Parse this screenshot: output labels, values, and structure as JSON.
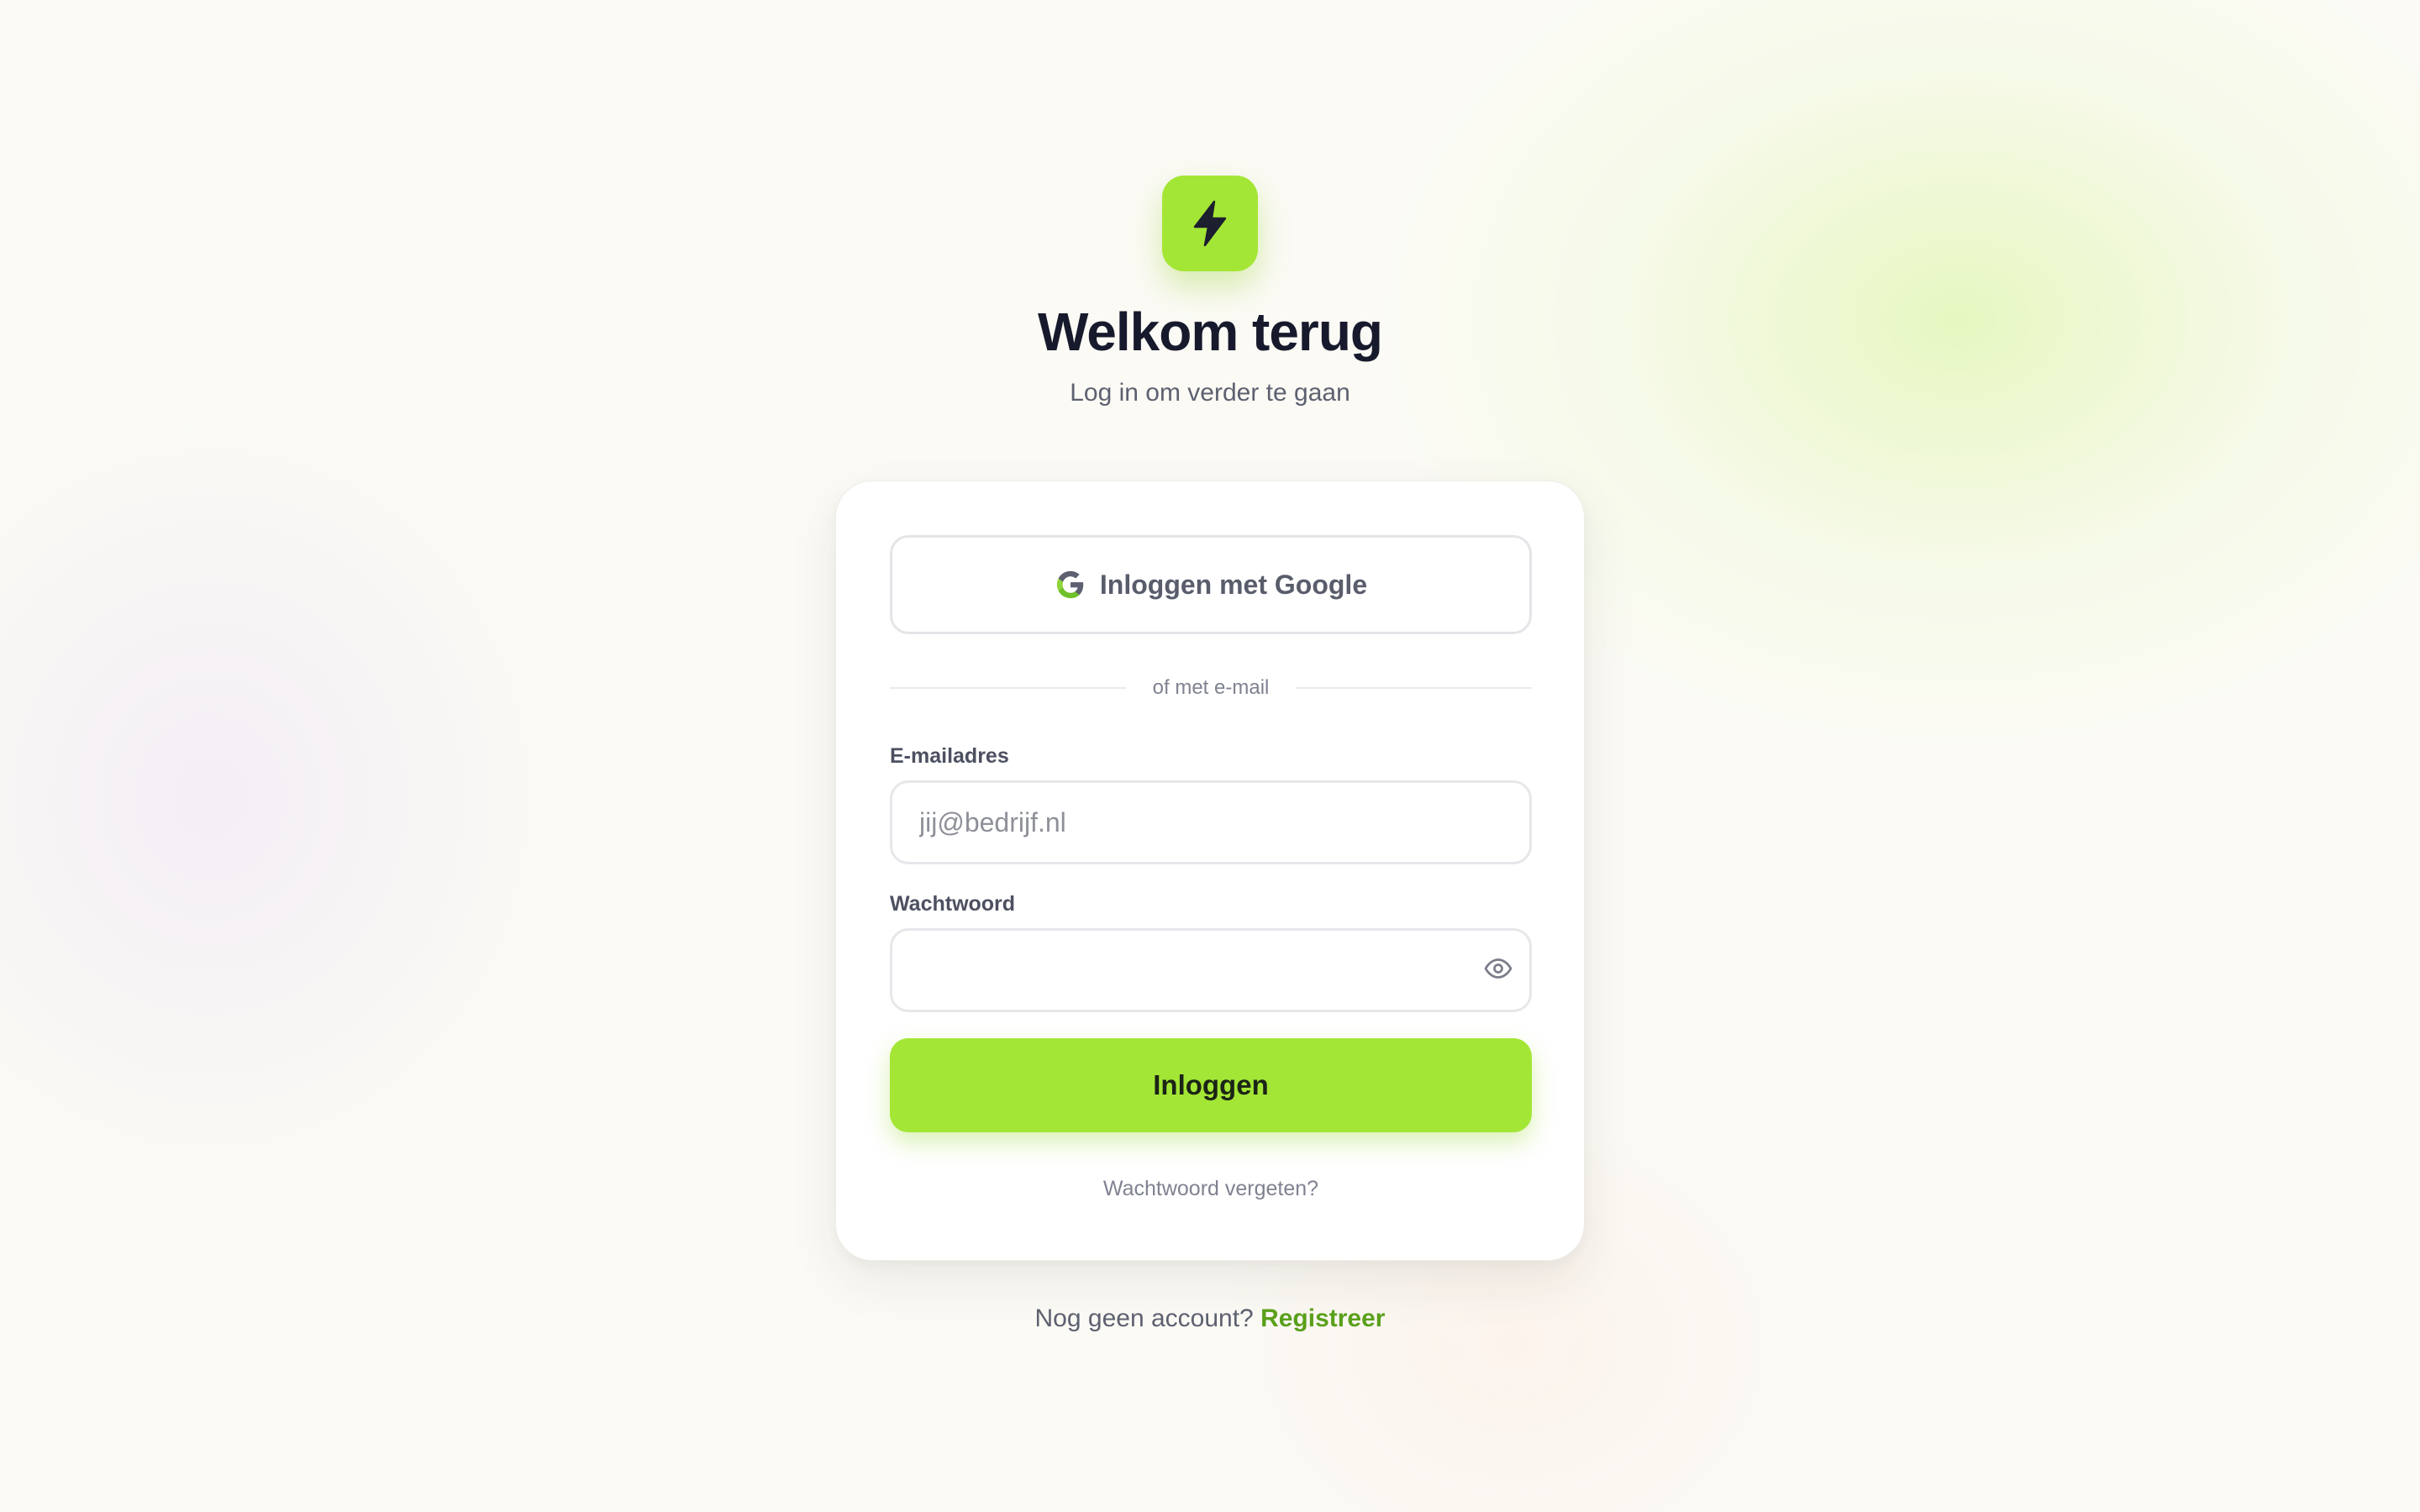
{
  "brand": {
    "accent_color": "#a3e635",
    "link_color": "#5aa01b",
    "logo_icon": "lightning-bolt-icon"
  },
  "header": {
    "title": "Welkom terug",
    "subtitle": "Log in om verder te gaan"
  },
  "card": {
    "google_button_label": "Inloggen met Google",
    "divider_text": "of met e-mail",
    "email": {
      "label": "E-mailadres",
      "placeholder": "jij@bedrijf.nl",
      "value": ""
    },
    "password": {
      "label": "Wachtwoord",
      "placeholder": "",
      "value": ""
    },
    "submit_label": "Inloggen",
    "forgot_label": "Wachtwoord vergeten?"
  },
  "footer": {
    "prompt": "Nog geen account?",
    "register_label": "Registreer"
  }
}
